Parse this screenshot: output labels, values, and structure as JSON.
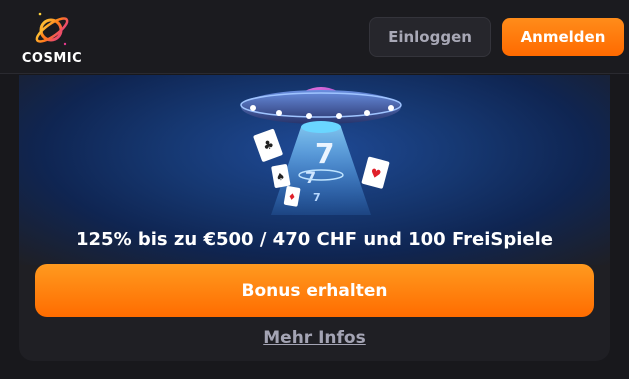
{
  "header": {
    "brand": "COSMIC",
    "login_label": "Einloggen",
    "register_label": "Anmelden"
  },
  "promo": {
    "offer_text": "125% bis zu €500 / 470 CHF und 100 FreiSpiele",
    "bonus_button_label": "Bonus erhalten",
    "more_info_label": "Mehr Infos"
  },
  "colors": {
    "accent": "#ff7a00",
    "background": "#18181c",
    "card": "#1f1f24",
    "banner": "#163872"
  },
  "icons": {
    "logo": "cosmic-planet-logo",
    "illustration": "ufo-with-playing-cards"
  }
}
